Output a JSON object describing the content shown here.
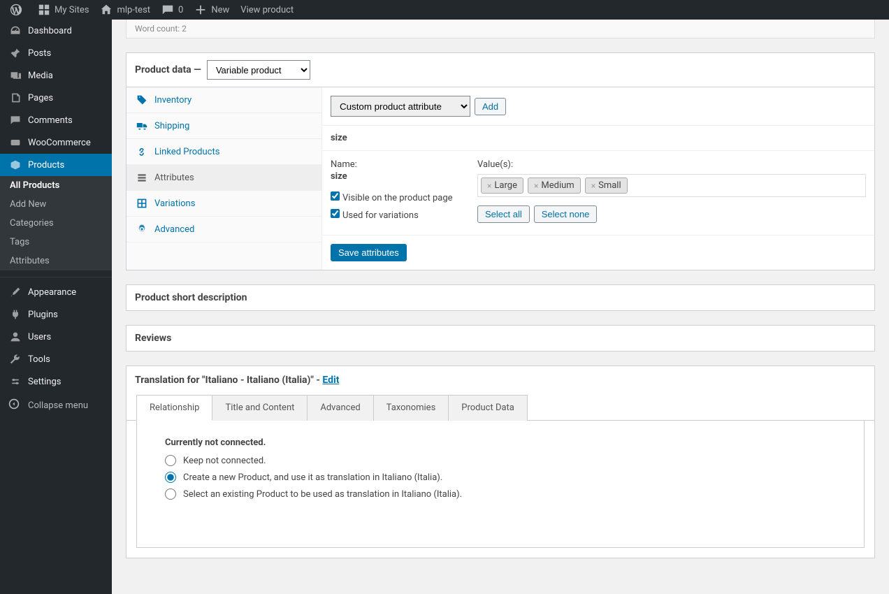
{
  "adminbar": {
    "my_sites": "My Sites",
    "site_name": "mlp-test",
    "comments": "0",
    "new": "New",
    "view": "View product"
  },
  "menu": {
    "dashboard": "Dashboard",
    "posts": "Posts",
    "media": "Media",
    "pages": "Pages",
    "comments": "Comments",
    "woocommerce": "WooCommerce",
    "products": "Products",
    "products_sub": {
      "all": "All Products",
      "add_new": "Add New",
      "categories": "Categories",
      "tags": "Tags",
      "attributes": "Attributes"
    },
    "appearance": "Appearance",
    "plugins": "Plugins",
    "users": "Users",
    "tools": "Tools",
    "settings": "Settings",
    "collapse": "Collapse menu"
  },
  "wordcount": "Word count: 2",
  "product_data": {
    "label": "Product data —",
    "type": "Variable product",
    "tabs": {
      "inventory": "Inventory",
      "shipping": "Shipping",
      "linked": "Linked Products",
      "attributes": "Attributes",
      "variations": "Variations",
      "advanced": "Advanced"
    },
    "attr_dropdown": "Custom product attribute",
    "add_btn": "Add",
    "attribute": {
      "title": "size",
      "name_label": "Name:",
      "name": "size",
      "visible": "Visible on the product page",
      "used_variations": "Used for variations",
      "values_label": "Value(s):",
      "values": [
        "Large",
        "Medium",
        "Small"
      ],
      "select_all": "Select all",
      "select_none": "Select none"
    },
    "save": "Save attributes"
  },
  "short_desc": "Product short description",
  "reviews": "Reviews",
  "translation": {
    "title_prefix": "Translation for \"Italiano - Italiano (Italia)\" - ",
    "edit": "Edit",
    "tabs": {
      "relationship": "Relationship",
      "title_content": "Title and Content",
      "advanced": "Advanced",
      "taxonomies": "Taxonomies",
      "product_data": "Product Data"
    },
    "heading": "Currently not connected.",
    "options": {
      "keep": "Keep not connected.",
      "create": "Create a new Product, and use it as translation in Italiano (Italia).",
      "select": "Select an existing Product to be used as translation in Italiano (Italia)."
    }
  }
}
